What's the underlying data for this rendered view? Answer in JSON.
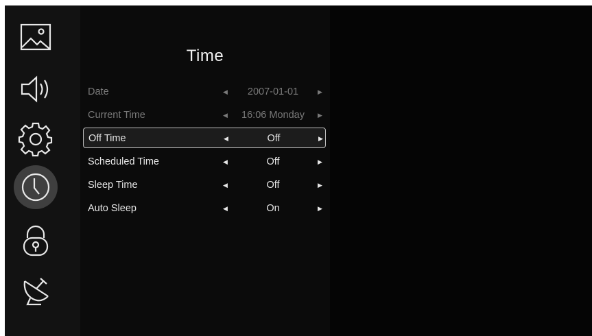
{
  "sidebar": {
    "items": [
      {
        "icon": "picture-icon"
      },
      {
        "icon": "sound-icon"
      },
      {
        "icon": "settings-gear-icon"
      },
      {
        "icon": "clock-icon",
        "active": true
      },
      {
        "icon": "lock-icon"
      },
      {
        "icon": "satellite-dish-icon"
      }
    ]
  },
  "panel": {
    "title": "Time",
    "arrow_left": "◀",
    "arrow_right": "▶",
    "rows": [
      {
        "label": "Date",
        "value": "2007-01-01",
        "state": "disabled"
      },
      {
        "label": "Current Time",
        "value": "16:06 Monday",
        "state": "disabled"
      },
      {
        "label": "Off Time",
        "value": "Off",
        "state": "selected"
      },
      {
        "label": "Scheduled Time",
        "value": "Off",
        "state": "normal"
      },
      {
        "label": "Sleep Time",
        "value": "Off",
        "state": "normal"
      },
      {
        "label": "Auto Sleep",
        "value": "On",
        "state": "normal"
      }
    ]
  },
  "colors": {
    "background": "#050505",
    "sidebar": "#121212",
    "text": "#e6e6e6",
    "disabled_text": "#7a7a7a",
    "selection_border": "#bdbdbd"
  }
}
